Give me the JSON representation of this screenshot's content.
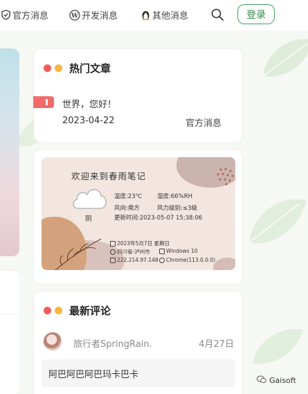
{
  "nav": {
    "items": [
      {
        "label": "官方消息",
        "icon": "shield-check-icon"
      },
      {
        "label": "开发消息",
        "icon": "wordpress-icon"
      },
      {
        "label": "其他消息",
        "icon": "penguin-icon"
      }
    ],
    "search_icon": "search-icon",
    "login_label": "登录"
  },
  "hot_articles": {
    "title": "热门文章",
    "post_title": "世界，您好！",
    "post_date": "2023-04-22",
    "post_category": "官方消息"
  },
  "weather": {
    "greeting": "欢迎来到春雨笔记",
    "temperature": "温度:23℃",
    "humidity": "湿度:66%RH",
    "condition": "阴",
    "wind_dir": "风向:南方",
    "wind_level": "风力级别:≤3级",
    "updated": "更新时间:2023-05-07 15:38:06",
    "date": "2023年5月7日 星期日",
    "location": "四川省-泸州市",
    "ip": "222.214.97.148",
    "os": "Windows 10",
    "browser": "Chrome(113.0.0.0)"
  },
  "latest_comments": {
    "title": "最新评论",
    "author": "旅行者SpringRain.",
    "date": "4月27日",
    "text": "阿巴阿巴阿巴玛卡巴卡"
  },
  "watermark": "Gaisoft",
  "colors": {
    "dot_red": "#f25c5c",
    "dot_yellow": "#f6b73c",
    "accent_green": "#3aa35a",
    "hot_tag": "#f26a6a"
  }
}
